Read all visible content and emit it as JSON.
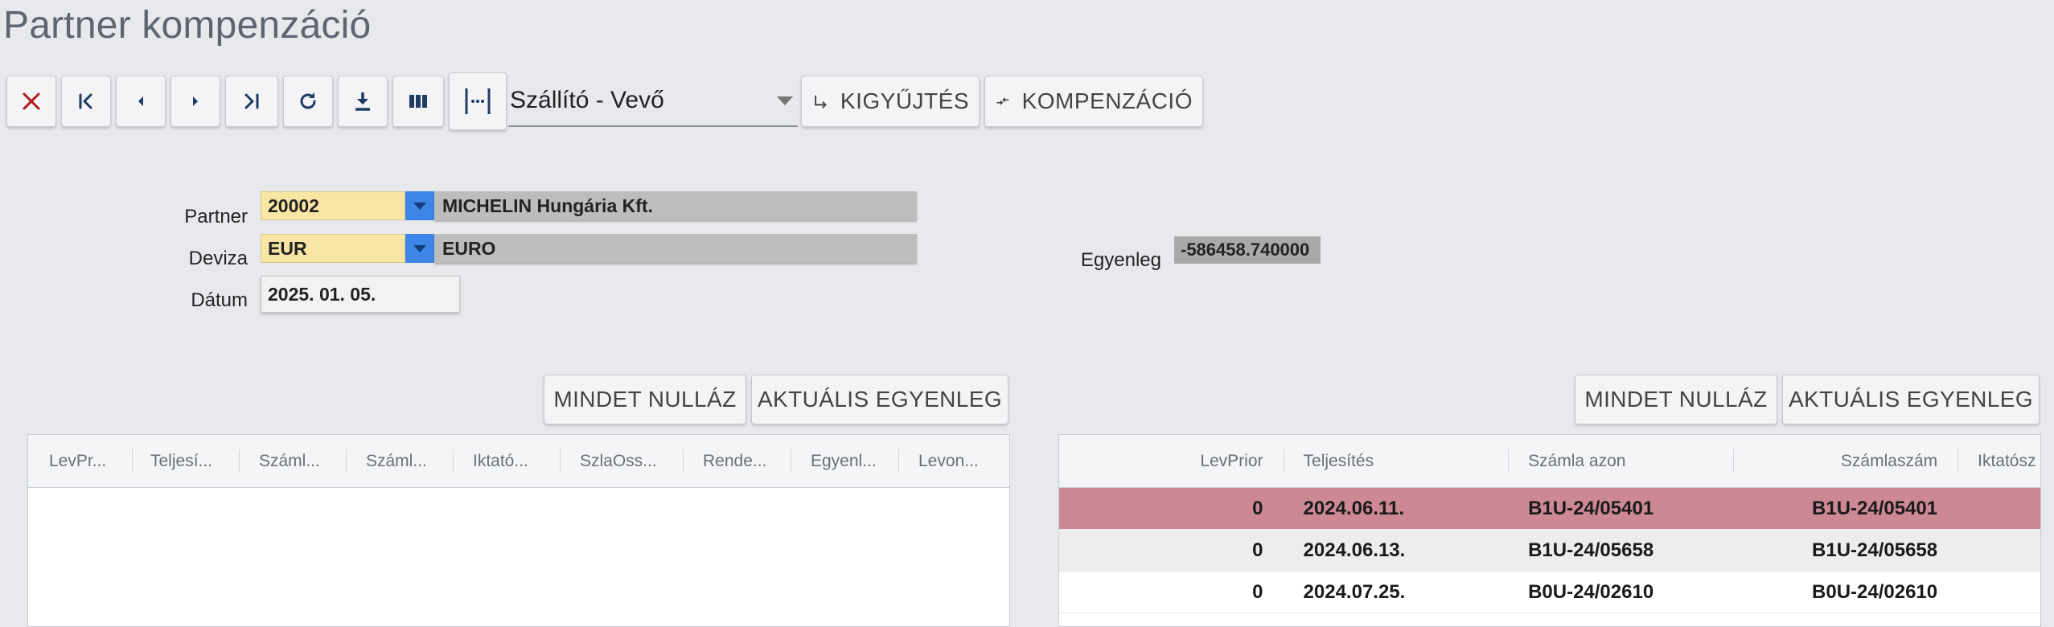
{
  "page": {
    "title": "Partner kompenzáció"
  },
  "toolbar": {
    "mode_select": {
      "value": "Szállító - Vevő"
    },
    "collect_label": "KIGYŰJTÉS",
    "compensate_label": "KOMPENZÁCIÓ",
    "icons": [
      "close-icon",
      "first-page-icon",
      "prev-icon",
      "next-icon",
      "last-page-icon",
      "refresh-icon",
      "download-icon",
      "columns-icon",
      "fit-width-icon"
    ]
  },
  "form": {
    "partner": {
      "label": "Partner",
      "code": "20002",
      "name": "MICHELIN Hungária Kft."
    },
    "currency": {
      "label": "Deviza",
      "code": "EUR",
      "name": "EURO"
    },
    "date": {
      "label": "Dátum",
      "value": "2025. 01. 05."
    },
    "balance": {
      "label": "Egyenleg",
      "value": "-586458.740000"
    }
  },
  "left_panel": {
    "reset_label": "MINDET NULLÁZ",
    "balance_label": "AKTUÁLIS EGYENLEG",
    "columns": [
      "LevPr...",
      "Teljesí...",
      "Száml...",
      "Száml...",
      "Iktató...",
      "SzlaOss...",
      "Rende...",
      "Egyenl...",
      "Levon..."
    ],
    "rows": []
  },
  "right_panel": {
    "reset_label": "MINDET NULLÁZ",
    "balance_label": "AKTUÁLIS EGYENLEG",
    "columns": [
      "LevPrior",
      "Teljesítés",
      "Számla azon",
      "Számlaszám",
      "Iktatósz"
    ],
    "rows": [
      {
        "levprior": "0",
        "teljesites": "2024.06.11.",
        "szamla_azon": "B1U-24/05401",
        "szamlaszam": "B1U-24/05401"
      },
      {
        "levprior": "0",
        "teljesites": "2024.06.13.",
        "szamla_azon": "B1U-24/05658",
        "szamlaszam": "B1U-24/05658"
      },
      {
        "levprior": "0",
        "teljesites": "2024.07.25.",
        "szamla_azon": "B0U-24/02610",
        "szamlaszam": "B0U-24/02610"
      }
    ]
  },
  "colors": {
    "background": "#e8e9ed",
    "code_field": "#fae6a4",
    "dropdown_button": "#3d86e8",
    "selected_row": "#cc8894",
    "close_icon": "#b01c1c",
    "nav_icon": "#1f3b66"
  }
}
